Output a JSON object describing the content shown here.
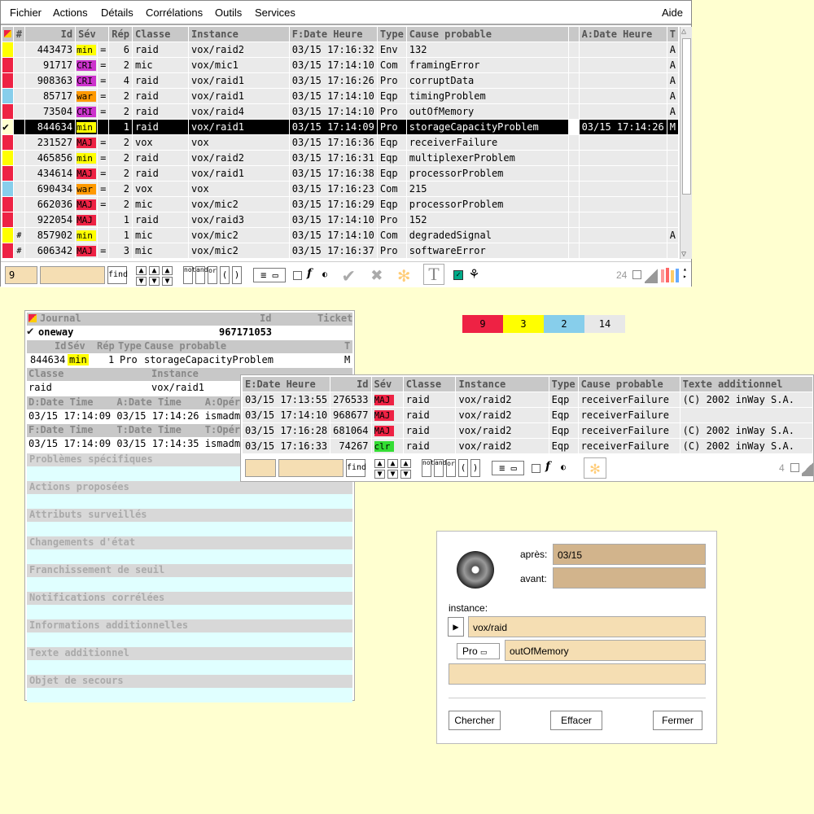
{
  "menu": [
    "Fichier",
    "Actions",
    "Détails",
    "Corrélations",
    "Outils",
    "Services"
  ],
  "help": "Aide",
  "colors": {
    "MAJ": "#ee2244",
    "min": "#ffff00",
    "CRI": "#cc33cc",
    "war": "#ff9900",
    "clr": "#33dd33",
    "war_mark": "#87ceeb",
    "background": "#ffffd0",
    "field": "#f5deb3"
  },
  "main_table": {
    "headers": [
      "#",
      "Id",
      "Sév",
      "Rép",
      "Classe",
      "Instance",
      "F:Date Heure",
      "Type",
      "Cause probable",
      "",
      "A:Date Heure",
      "T"
    ],
    "rows": [
      {
        "mark": "min",
        "hash": "",
        "id": "443473",
        "sev": "min",
        "eq": "=",
        "rep": "6",
        "classe": "raid",
        "inst": "vox/raid2",
        "date": "03/15 17:16:32",
        "type": "Env",
        "cause": "132",
        "adate": "",
        "t": "A"
      },
      {
        "mark": "MAJ",
        "hash": "",
        "id": "91717",
        "sev": "CRI",
        "eq": "=",
        "rep": "2",
        "classe": "mic",
        "inst": "vox/mic1",
        "date": "03/15 17:14:10",
        "type": "Com",
        "cause": "framingError",
        "adate": "",
        "t": "A"
      },
      {
        "mark": "MAJ",
        "hash": "",
        "id": "908363",
        "sev": "CRI",
        "eq": "=",
        "rep": "4",
        "classe": "raid",
        "inst": "vox/raid1",
        "date": "03/15 17:16:26",
        "type": "Pro",
        "cause": "corruptData",
        "adate": "",
        "t": "A"
      },
      {
        "mark": "war",
        "hash": "",
        "id": "85717",
        "sev": "war",
        "eq": "=",
        "rep": "2",
        "classe": "raid",
        "inst": "vox/raid1",
        "date": "03/15 17:14:10",
        "type": "Eqp",
        "cause": "timingProblem",
        "adate": "",
        "t": "A"
      },
      {
        "mark": "MAJ",
        "hash": "",
        "id": "73504",
        "sev": "CRI",
        "eq": "=",
        "rep": "2",
        "classe": "raid",
        "inst": "vox/raid4",
        "date": "03/15 17:14:10",
        "type": "Pro",
        "cause": "outOfMemory",
        "adate": "",
        "t": "A"
      },
      {
        "mark": "check",
        "hash": "",
        "id": "844634",
        "sev": "min",
        "eq": "",
        "rep": "1",
        "classe": "raid",
        "inst": "vox/raid1",
        "date": "03/15 17:14:09",
        "type": "Pro",
        "cause": "storageCapacityProblem",
        "adate": "03/15 17:14:26",
        "t": "M",
        "selected": true
      },
      {
        "mark": "MAJ",
        "hash": "",
        "id": "231527",
        "sev": "MAJ",
        "eq": "=",
        "rep": "2",
        "classe": "vox",
        "inst": "vox",
        "date": "03/15 17:16:36",
        "type": "Eqp",
        "cause": "receiverFailure",
        "adate": "",
        "t": ""
      },
      {
        "mark": "min",
        "hash": "",
        "id": "465856",
        "sev": "min",
        "eq": "=",
        "rep": "2",
        "classe": "raid",
        "inst": "vox/raid2",
        "date": "03/15 17:16:31",
        "type": "Eqp",
        "cause": "multiplexerProblem",
        "adate": "",
        "t": ""
      },
      {
        "mark": "MAJ",
        "hash": "",
        "id": "434614",
        "sev": "MAJ",
        "eq": "=",
        "rep": "2",
        "classe": "raid",
        "inst": "vox/raid1",
        "date": "03/15 17:16:38",
        "type": "Eqp",
        "cause": "processorProblem",
        "adate": "",
        "t": ""
      },
      {
        "mark": "war",
        "hash": "",
        "id": "690434",
        "sev": "war",
        "eq": "=",
        "rep": "2",
        "classe": "vox",
        "inst": "vox",
        "date": "03/15 17:16:23",
        "type": "Com",
        "cause": "215",
        "adate": "",
        "t": ""
      },
      {
        "mark": "MAJ",
        "hash": "",
        "id": "662036",
        "sev": "MAJ",
        "eq": "=",
        "rep": "2",
        "classe": "mic",
        "inst": "vox/mic2",
        "date": "03/15 17:16:29",
        "type": "Eqp",
        "cause": "processorProblem",
        "adate": "",
        "t": ""
      },
      {
        "mark": "MAJ",
        "hash": "",
        "id": "922054",
        "sev": "MAJ",
        "eq": "",
        "rep": "1",
        "classe": "raid",
        "inst": "vox/raid3",
        "date": "03/15 17:14:10",
        "type": "Pro",
        "cause": "152",
        "adate": "",
        "t": ""
      },
      {
        "mark": "min",
        "hash": "#",
        "id": "857902",
        "sev": "min",
        "eq": "",
        "rep": "1",
        "classe": "mic",
        "inst": "vox/mic2",
        "date": "03/15 17:14:10",
        "type": "Com",
        "cause": "degradedSignal",
        "adate": "",
        "t": "A"
      },
      {
        "mark": "MAJ",
        "hash": "#",
        "id": "606342",
        "sev": "MAJ",
        "eq": "=",
        "rep": "3",
        "classe": "mic",
        "inst": "vox/mic2",
        "date": "03/15 17:16:37",
        "type": "Pro",
        "cause": "softwareError",
        "adate": "",
        "t": ""
      }
    ]
  },
  "toolbar": {
    "field1": "9",
    "find": "find",
    "not": "not",
    "and": "and",
    "or": "or",
    "lparen": "(",
    "rparen": ")",
    "f": "f",
    "count": "24"
  },
  "counters": [
    {
      "value": "9",
      "color": "#ee2244"
    },
    {
      "value": "3",
      "color": "#ffff00"
    },
    {
      "value": "2",
      "color": "#87ceeb"
    },
    {
      "value": "14",
      "color": "#e8e8e8"
    }
  ],
  "journal": {
    "title": "Journal",
    "col_id": "Id",
    "col_ticket": "Ticket",
    "name": "oneway",
    "number": "967171053",
    "h2": {
      "id": "Id",
      "sev": "Sév",
      "rep": "Rép",
      "type": "Type",
      "cause": "Cause probable",
      "t": "T"
    },
    "v2": {
      "id": "844634",
      "sev": "min",
      "rep": "1",
      "type": "Pro",
      "cause": "storageCapacityProblem",
      "t": "M"
    },
    "h3": {
      "classe": "Classe",
      "inst": "Instance"
    },
    "v3": {
      "classe": "raid",
      "inst": "vox/raid1"
    },
    "h4": "D:Date Time    A:Date Time    A:Opéra",
    "v4": "03/15 17:14:09 03/15 17:14:26 ismadm",
    "h5": "F:Date Time    T:Date Time    T:Opéra",
    "v5": "03/15 17:14:09 03/15 17:14:35 ismadm",
    "sections": [
      "Problèmes spécifiques",
      "Actions proposées",
      "Attributs surveillés",
      "Changements d'état",
      "Franchissement de seuil",
      "Notifications corrélées",
      "Informations additionnelles",
      "Texte additionnel",
      "Objet de secours"
    ]
  },
  "sub_table": {
    "headers": [
      "E:Date Heure",
      "Id",
      "Sév",
      "Classe",
      "Instance",
      "Type",
      "Cause probable",
      "Texte additionnel"
    ],
    "rows": [
      {
        "date": "03/15 17:13:55",
        "id": "276533",
        "sev": "MAJ",
        "classe": "raid",
        "inst": "vox/raid2",
        "type": "Eqp",
        "cause": "receiverFailure",
        "texte": "(C) 2002 inWay S.A."
      },
      {
        "date": "03/15 17:14:10",
        "id": "968677",
        "sev": "MAJ",
        "classe": "raid",
        "inst": "vox/raid2",
        "type": "Eqp",
        "cause": "receiverFailure",
        "texte": ""
      },
      {
        "date": "03/15 17:16:28",
        "id": "681064",
        "sev": "MAJ",
        "classe": "raid",
        "inst": "vox/raid2",
        "type": "Eqp",
        "cause": "receiverFailure",
        "texte": "(C) 2002 inWay S.A."
      },
      {
        "date": "03/15 17:16:33",
        "id": "74267",
        "sev": "clr",
        "classe": "raid",
        "inst": "vox/raid2",
        "type": "Eqp",
        "cause": "receiverFailure",
        "texte": "(C) 2002 inWay S.A."
      }
    ],
    "count": "4"
  },
  "search": {
    "apres_label": "après:",
    "apres_value": "03/15",
    "avant_label": "avant:",
    "avant_value": "",
    "instance_label": "instance:",
    "instance_value": "vox/raid",
    "type_value": "Pro",
    "cause_value": "outOfMemory",
    "extra_value": "",
    "btn_search": "Chercher",
    "btn_clear": "Effacer",
    "btn_close": "Fermer"
  }
}
